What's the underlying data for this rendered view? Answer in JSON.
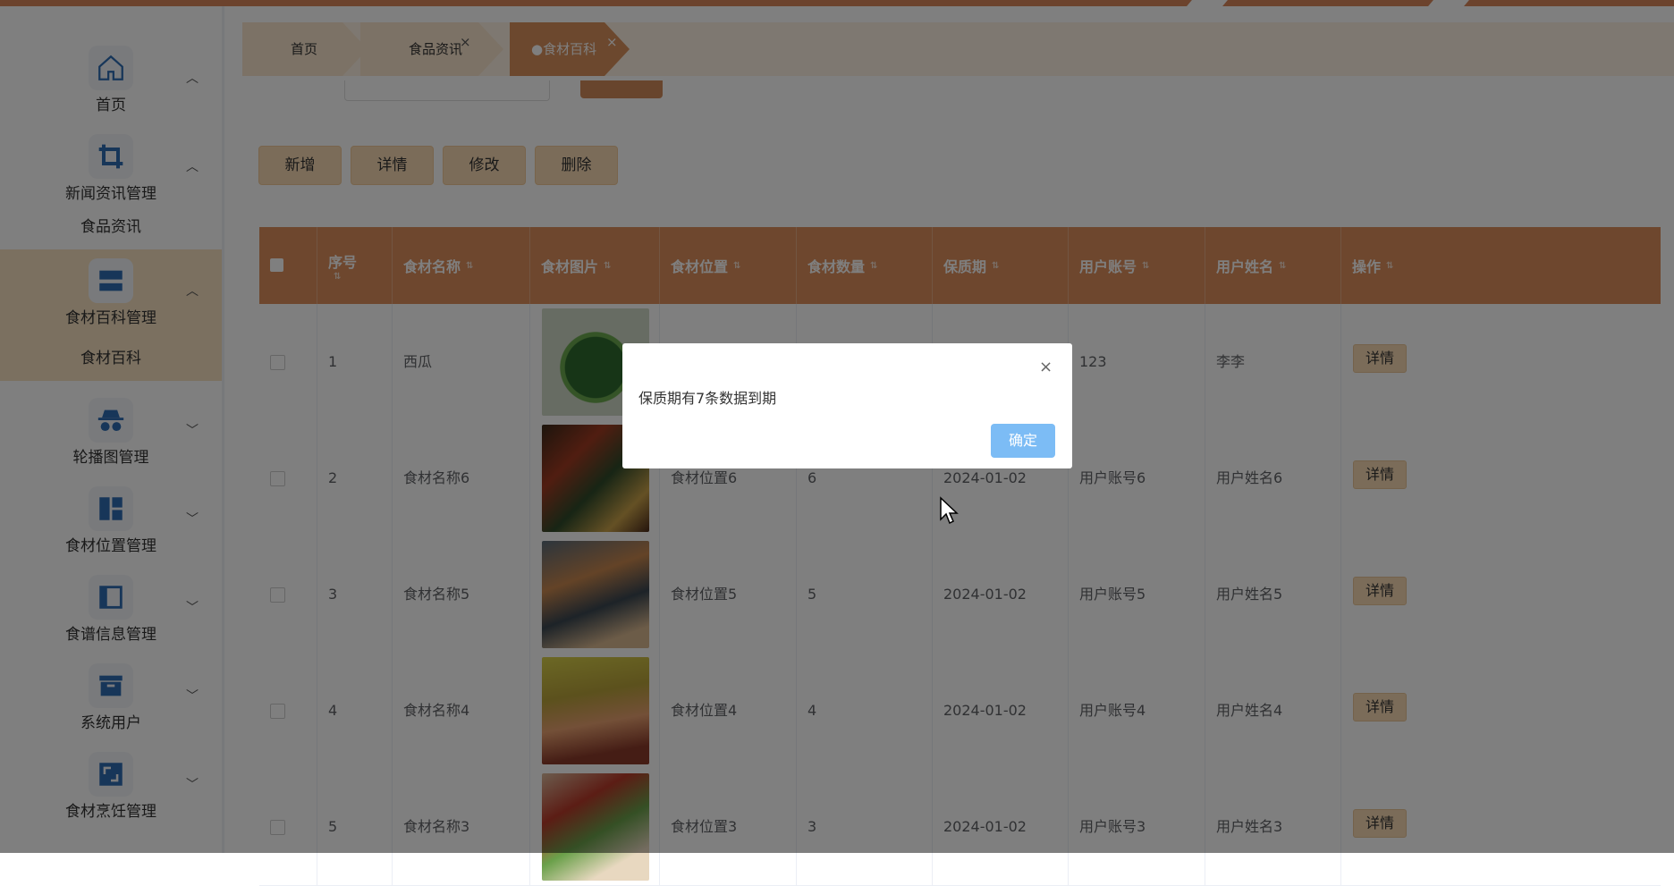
{
  "sidebar": {
    "items": [
      {
        "label": "首页",
        "icon": "home-icon",
        "chevron": "︿"
      },
      {
        "label": "新闻资讯管理",
        "icon": "crop-icon",
        "chevron": "︿",
        "sub": "食品资讯"
      },
      {
        "label": "食材百科管理",
        "icon": "layout-icon",
        "chevron": "︿",
        "sub": "食材百科"
      },
      {
        "label": "轮播图管理",
        "icon": "incognito-icon",
        "chevron": "﹀"
      },
      {
        "label": "食材位置管理",
        "icon": "dashboard-icon",
        "chevron": "﹀"
      },
      {
        "label": "食谱信息管理",
        "icon": "sidebar-layout-icon",
        "chevron": "﹀"
      },
      {
        "label": "系统用户",
        "icon": "archive-icon",
        "chevron": "﹀"
      },
      {
        "label": "食材烹饪管理",
        "icon": "expand-icon",
        "chevron": "﹀"
      }
    ]
  },
  "tabs": [
    {
      "label": "首页"
    },
    {
      "label": "食品资讯",
      "close": "×"
    },
    {
      "label": "●食材百科",
      "close": "×"
    }
  ],
  "toolbar": {
    "add": "新增",
    "detail": "详情",
    "edit": "修改",
    "delete": "删除"
  },
  "table": {
    "headers": [
      "序号",
      "食材名称",
      "食材图片",
      "食材位置",
      "食材数量",
      "保质期",
      "用户账号",
      "用户姓名",
      "操作"
    ],
    "sort_glyph": "⇅",
    "detail_label": "详情",
    "rows": [
      {
        "no": "1",
        "name": "西瓜",
        "location": "",
        "qty": "",
        "date": "",
        "account": "123",
        "user": "李李"
      },
      {
        "no": "2",
        "name": "食材名称6",
        "location": "食材位置6",
        "qty": "6",
        "date": "2024-01-02",
        "account": "用户账号6",
        "user": "用户姓名6"
      },
      {
        "no": "3",
        "name": "食材名称5",
        "location": "食材位置5",
        "qty": "5",
        "date": "2024-01-02",
        "account": "用户账号5",
        "user": "用户姓名5"
      },
      {
        "no": "4",
        "name": "食材名称4",
        "location": "食材位置4",
        "qty": "4",
        "date": "2024-01-02",
        "account": "用户账号4",
        "user": "用户姓名4"
      },
      {
        "no": "5",
        "name": "食材名称3",
        "location": "食材位置3",
        "qty": "3",
        "date": "2024-01-02",
        "account": "用户账号3",
        "user": "用户姓名3"
      }
    ]
  },
  "dialog": {
    "message": "保质期有7条数据到期",
    "ok": "确定",
    "close": "×"
  },
  "colors": {
    "accent": "#dd8f5c",
    "button": "#f6d9b2",
    "ok": "#7cbcf5"
  }
}
